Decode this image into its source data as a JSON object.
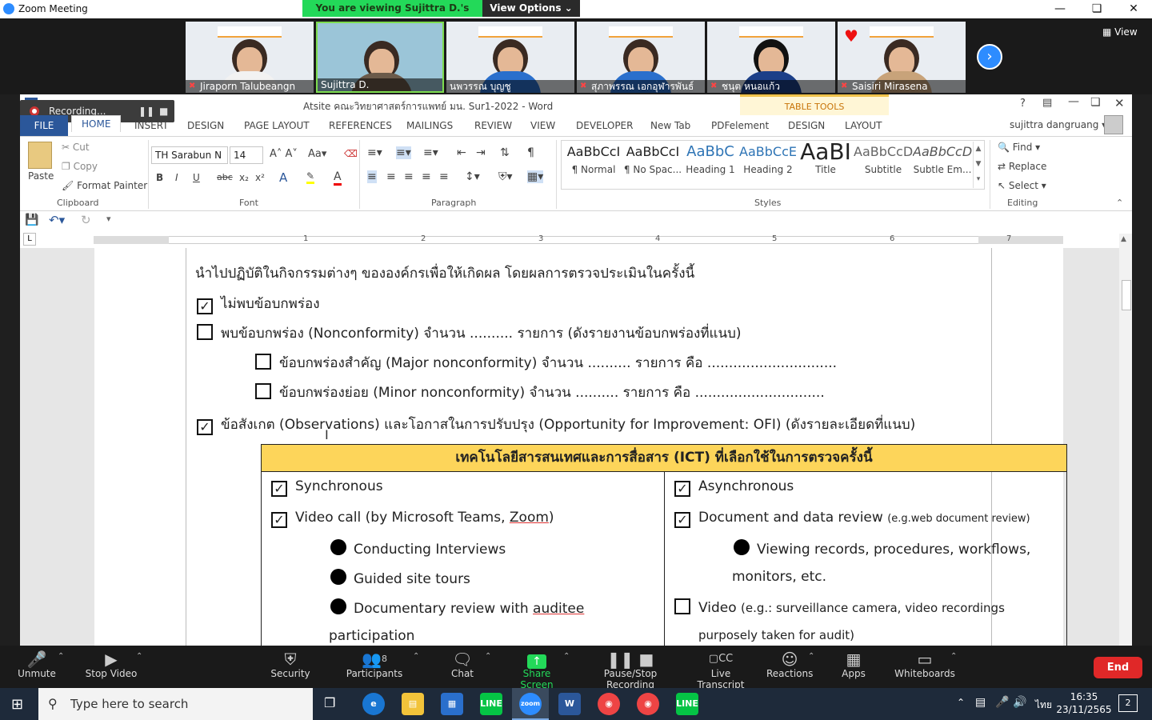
{
  "zoom": {
    "window_title": "Zoom Meeting",
    "viewing_banner": "You are viewing Sujittra D.'s screen",
    "view_options": "View Options ⌄",
    "view_button": "View",
    "participants": [
      {
        "name": "Jiraporn Talubeangn"
      },
      {
        "name": "Sujittra D."
      },
      {
        "name": "นพวรรณ บุญชู"
      },
      {
        "name": "สุภาพรรณ เอกอุฬารพันธ์"
      },
      {
        "name": "ชนุต หนอแก้ว"
      },
      {
        "name": "Saisiri Mirasena"
      }
    ],
    "toolbar": {
      "unmute": "Unmute",
      "stop_video": "Stop Video",
      "security": "Security",
      "participants": "Participants",
      "participants_count": "8",
      "chat": "Chat",
      "share_screen": "Share Screen",
      "pause_recording": "Pause/Stop Recording",
      "live_transcript": "Live Transcript",
      "reactions": "Reactions",
      "apps": "Apps",
      "whiteboards": "Whiteboards",
      "end": "End"
    },
    "recording_label": "Recording..."
  },
  "word": {
    "title": "Atsite คณะวิทยาศาสตร์การแพทย์ มน. Sur1-2022 - Word",
    "table_tools": "TABLE TOOLS",
    "user": "sujittra dangruang",
    "tabs": [
      "FILE",
      "HOME",
      "INSERT",
      "DESIGN",
      "PAGE LAYOUT",
      "REFERENCES",
      "MAILINGS",
      "REVIEW",
      "VIEW",
      "DEVELOPER",
      "New Tab",
      "PDFelement",
      "DESIGN",
      "LAYOUT"
    ],
    "clipboard": {
      "paste": "Paste",
      "cut": "Cut",
      "copy": "Copy",
      "format_painter": "Format Painter",
      "label": "Clipboard"
    },
    "font": {
      "name": "TH Sarabun N",
      "size": "14",
      "label": "Font"
    },
    "paragraph_label": "Paragraph",
    "styles": [
      {
        "sample": "AaBbCcI",
        "name": "¶ Normal"
      },
      {
        "sample": "AaBbCcI",
        "name": "¶ No Spac..."
      },
      {
        "sample": "AaBbC",
        "name": "Heading 1"
      },
      {
        "sample": "AaBbCcE",
        "name": "Heading 2"
      },
      {
        "sample": "AaBI",
        "name": "Title"
      },
      {
        "sample": "AaBbCcD",
        "name": "Subtitle"
      },
      {
        "sample": "AaBbCcD",
        "name": "Subtle Em..."
      }
    ],
    "styles_label": "Styles",
    "editing": {
      "find": "Find",
      "replace": "Replace",
      "select": "Select",
      "label": "Editing"
    },
    "ruler_numbers": [
      "1",
      "2",
      "3",
      "4",
      "5",
      "6",
      "7"
    ]
  },
  "document": {
    "intro": "นำไปปฏิบัติในกิจกรรมต่างๆ ขององค์กรเพื่อให้เกิดผล โดยผลการตรวจประเมินในครั้งนี้",
    "item_no_nc": "ไม่พบข้อบกพร่อง",
    "item_nc": "พบข้อบกพร่อง (Nonconformity) จำนวน .......... รายการ  (ดังรายงานข้อบกพร่องที่แนบ)",
    "item_major": "ข้อบกพร่องสำคัญ (Major nonconformity) จำนวน .......... รายการ คือ ..............................",
    "item_minor": "ข้อบกพร่องย่อย (Minor nonconformity) จำนวน .......... รายการ คือ ..............................",
    "item_obs": "ข้อสังเกต (Observations) และโอกาสในการปรับปรุง (Opportunity for Improvement: OFI) (ดังรายละเอียดที่แนบ)",
    "ict_header": "เทคโนโลยีสารสนเทศและการสื่อสาร (ICT) ที่เลือกใช้ในการตรวจครั้งนี้",
    "left": {
      "synchronous": "Synchronous",
      "video_call_prefix": "Video call (by Microsoft Teams, ",
      "video_call_zoom": "Zoom",
      "video_call_suffix": ")",
      "b1": "Conducting Interviews",
      "b2": "Guided site tours",
      "b3_prefix": "Documentary review with ",
      "b3_word": "auditee",
      "b3_cont": "participation"
    },
    "right": {
      "asynchronous": "Asynchronous",
      "doc_review": "Document and data review",
      "doc_review_small": "(e.g.web document review)",
      "b1": "Viewing records, procedures, workflows,",
      "b1_cont": "monitors, etc.",
      "video": "Video",
      "video_small": "(e.g.: surveillance camera, video recordings",
      "video_cont": "purposely taken for audit)"
    }
  },
  "taskbar": {
    "search_placeholder": "Type here to search",
    "time": "16:35",
    "date": "23/11/2565",
    "lang": "ไทย",
    "notifications": "2"
  }
}
